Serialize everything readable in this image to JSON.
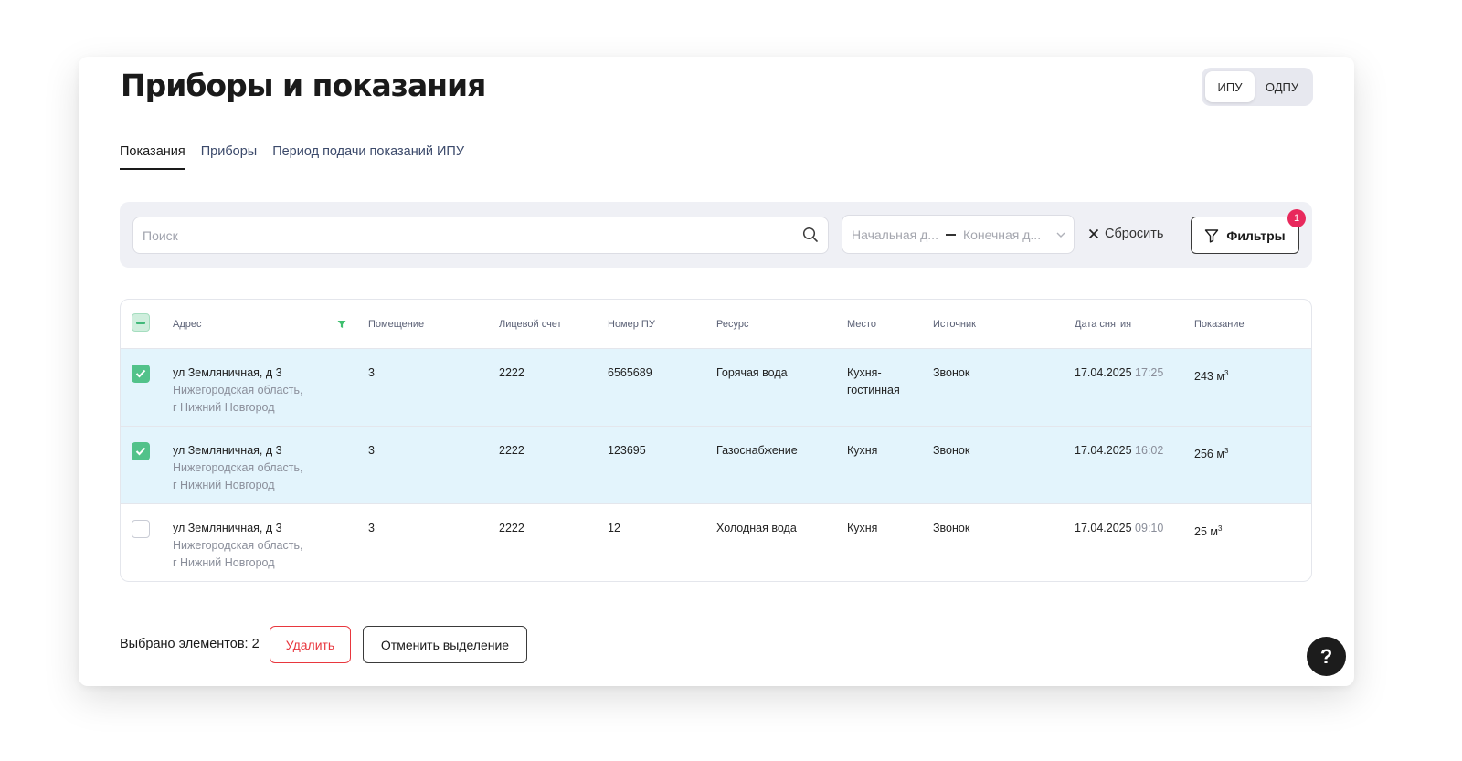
{
  "page": {
    "title": "Приборы и показания"
  },
  "toggle": {
    "options": [
      {
        "label": "ИПУ",
        "active": true
      },
      {
        "label": "ОДПУ",
        "active": false
      }
    ]
  },
  "tabs": [
    {
      "label": "Показания",
      "active": true
    },
    {
      "label": "Приборы",
      "active": false
    },
    {
      "label": "Период подачи показаний ИПУ",
      "active": false
    }
  ],
  "filters": {
    "search_placeholder": "Поиск",
    "date_start_placeholder": "Начальная д...",
    "date_end_placeholder": "Конечная д...",
    "reset_label": "Сбросить",
    "filters_label": "Фильтры",
    "filters_count": "1"
  },
  "table": {
    "columns": [
      "Адрес",
      "Помещение",
      "Лицевой счет",
      "Номер ПУ",
      "Ресурс",
      "Место",
      "Источник",
      "Дата снятия",
      "Показание"
    ],
    "rows": [
      {
        "selected": true,
        "address_main": "ул Земляничная, д 3",
        "address_region": "Нижегородская область,",
        "address_city": "г Нижний Новгород",
        "room": "3",
        "account": "2222",
        "meter_number": "6565689",
        "resource": "Горячая вода",
        "place_line1": "Кухня-",
        "place_line2": "гостинная",
        "source": "Звонок",
        "date": "17.04.2025",
        "time": "17:25",
        "reading": "243 м",
        "unit_sup": "3"
      },
      {
        "selected": true,
        "address_main": "ул Земляничная, д 3",
        "address_region": "Нижегородская область,",
        "address_city": "г Нижний Новгород",
        "room": "3",
        "account": "2222",
        "meter_number": "123695",
        "resource": "Газоснабжение",
        "place_line1": "Кухня",
        "place_line2": "",
        "source": "Звонок",
        "date": "17.04.2025",
        "time": "16:02",
        "reading": "256 м",
        "unit_sup": "3"
      },
      {
        "selected": false,
        "address_main": "ул Земляничная, д 3",
        "address_region": "Нижегородская область,",
        "address_city": "г Нижний Новгород",
        "room": "3",
        "account": "2222",
        "meter_number": "12",
        "resource": "Холодная вода",
        "place_line1": "Кухня",
        "place_line2": "",
        "source": "Звонок",
        "date": "17.04.2025",
        "time": "09:10",
        "reading": "25 м",
        "unit_sup": "3"
      }
    ]
  },
  "footer": {
    "selected_text": "Выбрано элементов: 2",
    "delete_label": "Удалить",
    "cancel_label": "Отменить выделение"
  },
  "help": {
    "label": "?"
  },
  "colors": {
    "accent_green": "#52c28a",
    "danger": "#e8373e",
    "badge": "#e8295c",
    "selected_row": "#e3f4fc"
  }
}
